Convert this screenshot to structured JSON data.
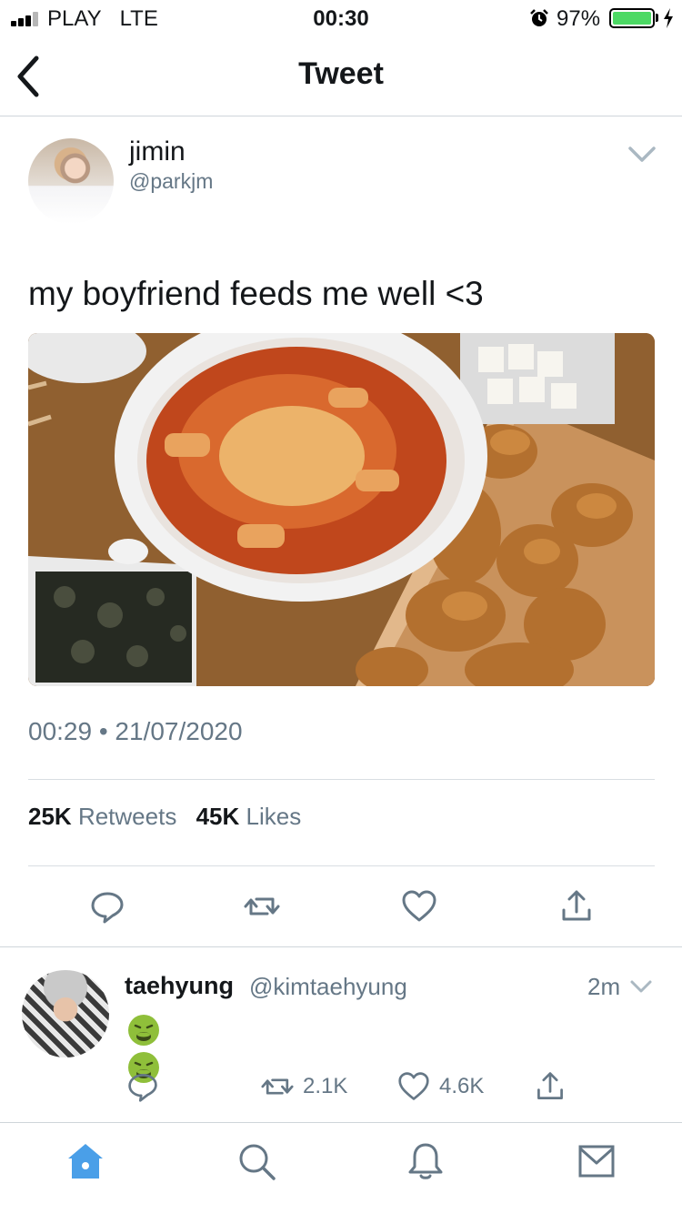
{
  "status_bar": {
    "carrier": "PLAY",
    "network": "LTE",
    "time": "00:30",
    "battery_percent": "97%",
    "battery_level": 0.97,
    "battery_color": "#4cd964"
  },
  "nav": {
    "title": "Tweet",
    "back_icon": "chevron-left-icon"
  },
  "tweet": {
    "author_name": "jimin",
    "author_handle": "@parkjm",
    "text": "my boyfriend feeds me well <3",
    "photo_alt": "tteokbokki with cheese, fried chicken and seaweed rice balls",
    "timestamp": "00:29 • 21/07/2020",
    "retweets_count": "25K",
    "retweets_label": "Retweets",
    "likes_count": "45K",
    "likes_label": "Likes",
    "actions": [
      "reply-icon",
      "retweet-icon",
      "heart-icon",
      "share-icon"
    ]
  },
  "reply": {
    "author_name": "taehyung",
    "author_handle": "@kimtaehyung",
    "time": "2m",
    "emoji": [
      "nauseated-face-icon",
      "nauseated-face-icon"
    ],
    "retweets": "2.1K",
    "likes": "4.6K"
  },
  "tab_bar": {
    "tabs": [
      "home-icon",
      "search-icon",
      "bell-icon",
      "mail-icon"
    ],
    "active": "home-icon",
    "accent": "#4a9fe8"
  },
  "colors": {
    "text": "#14171a",
    "muted": "#657786",
    "accent": "#4a9fe8"
  }
}
